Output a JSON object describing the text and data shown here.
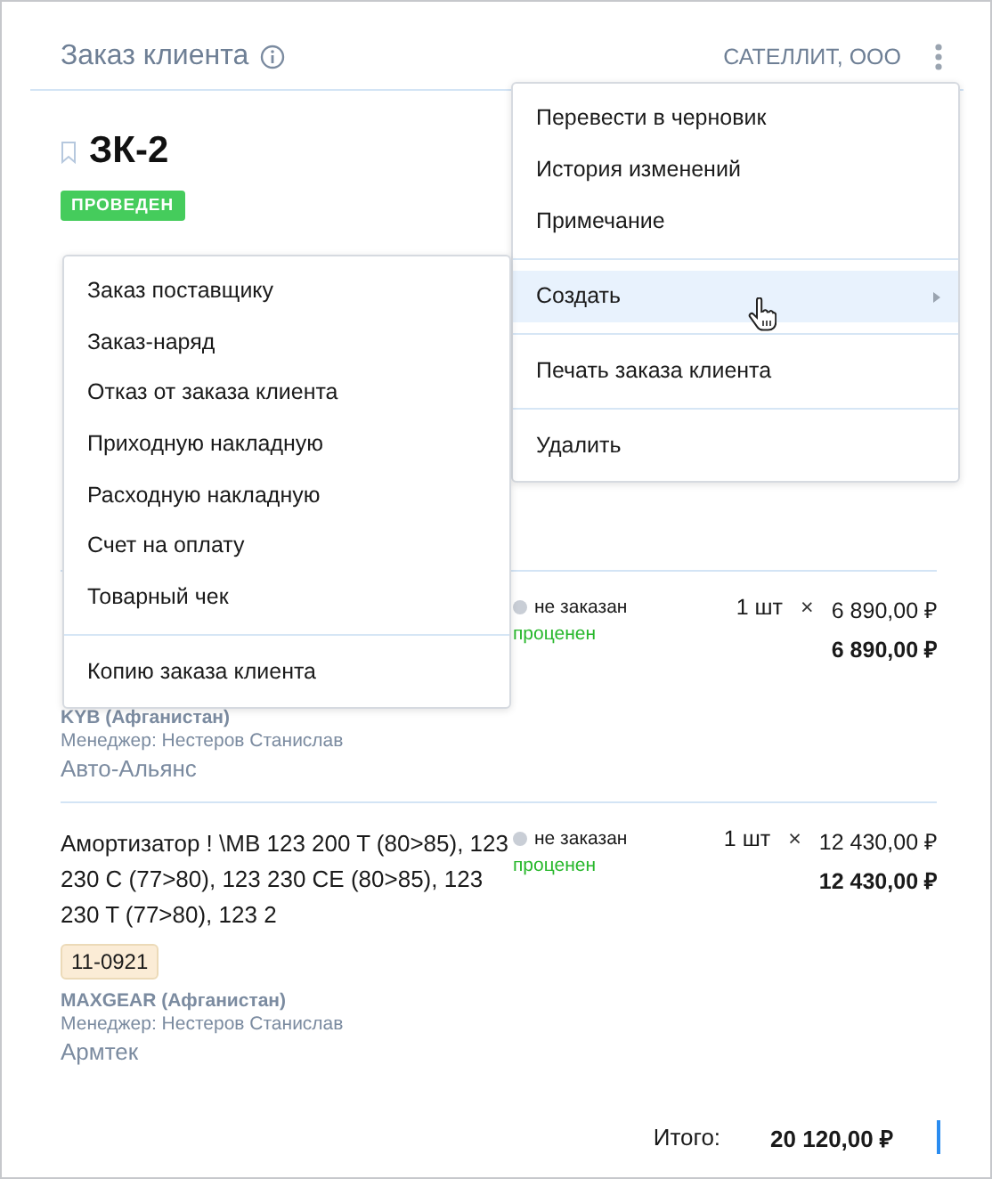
{
  "header": {
    "title": "Заказ клиента",
    "company": "САТЕЛЛИТ, ООО"
  },
  "order": {
    "number": "ЗК-2",
    "status": "ПРОВЕДЕН"
  },
  "items": [
    {
      "status": "не заказан",
      "pricing": "проценен",
      "qty": "1 шт",
      "times": "×",
      "unit_price": "6 890,00 ₽",
      "total": "6 890,00 ₽",
      "brand": "KYB (Афганистан)",
      "manager": "Менеджер: Нестеров Станислав",
      "supplier": "Авто-Альянс"
    },
    {
      "name": "Амортизатор ! \\MB 123 200 T (80>85), 123 230 C (77>80), 123 230 CE (80>85), 123 230 T (77>80), 123 2",
      "code": "11-0921",
      "status": "не заказан",
      "pricing": "проценен",
      "qty": "1 шт",
      "times": "×",
      "unit_price": "12 430,00 ₽",
      "total": "12 430,00 ₽",
      "brand": "MAXGEAR (Афганистан)",
      "manager": "Менеджер: Нестеров Станислав",
      "supplier": "Армтек"
    }
  ],
  "summary": {
    "label": "Итого:",
    "value": "20 120,00 ₽"
  },
  "menu": {
    "groups": [
      [
        {
          "label": "Перевести в черновик",
          "kind": "item",
          "selected": false
        },
        {
          "label": "История изменений",
          "kind": "item",
          "selected": false
        },
        {
          "label": "Примечание",
          "kind": "item",
          "selected": false
        }
      ],
      [
        {
          "label": "Создать",
          "kind": "submenu",
          "selected": true
        }
      ],
      [
        {
          "label": "Печать заказа клиента",
          "kind": "item",
          "selected": false
        }
      ],
      [
        {
          "label": "Удалить",
          "kind": "item",
          "selected": false
        }
      ]
    ]
  },
  "submenu": {
    "groups": [
      [
        {
          "label": "Заказ поставщику",
          "selected": false
        },
        {
          "label": "Заказ-наряд",
          "selected": false
        },
        {
          "label": "Отказ от заказа клиента",
          "selected": false
        },
        {
          "label": "Приходную накладную",
          "selected": false
        },
        {
          "label": "Расходную накладную",
          "selected": false
        },
        {
          "label": "Счет на оплату",
          "selected": false
        },
        {
          "label": "Товарный чек",
          "selected": false
        }
      ],
      [
        {
          "label": "Копию заказа клиента",
          "selected": false
        }
      ]
    ]
  }
}
